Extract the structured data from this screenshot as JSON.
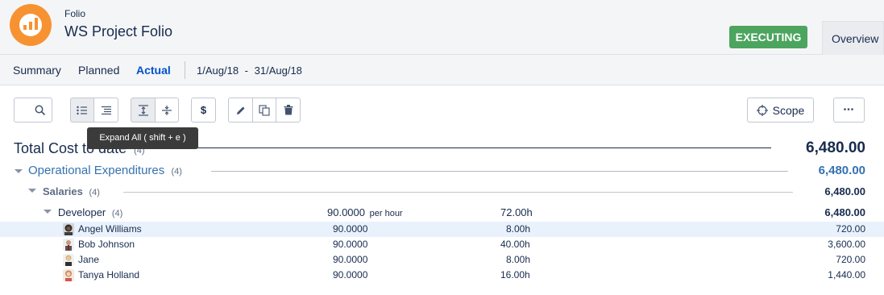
{
  "header": {
    "app_label": "Folio",
    "project_title": "WS Project Folio",
    "status": "EXECUTING",
    "overview_tab": "Overview"
  },
  "nav": {
    "tabs": [
      {
        "label": "Summary",
        "active": false
      },
      {
        "label": "Planned",
        "active": false
      },
      {
        "label": "Actual",
        "active": true
      }
    ],
    "date_from": "1/Aug/18",
    "date_sep": "-",
    "date_to": "31/Aug/18"
  },
  "toolbar": {
    "icons": [
      "search-icon",
      "list-view-icon",
      "indented-list-icon",
      "expand-all-icon",
      "collapse-all-icon",
      "currency-icon",
      "edit-icon",
      "copy-icon",
      "delete-icon",
      "target-icon",
      "more-icon"
    ],
    "currency_symbol": "$",
    "scope_label": "Scope",
    "more_label": "•••",
    "tooltip": "Expand All ( shift + e )"
  },
  "totals": {
    "label": "Total Cost to date",
    "count": "(4)",
    "amount": "6,480.00"
  },
  "groups": {
    "opex": {
      "label": "Operational Expenditures",
      "count": "(4)",
      "amount": "6,480.00"
    },
    "salaries": {
      "label": "Salaries",
      "count": "(4)",
      "amount": "6,480.00"
    },
    "developer": {
      "label": "Developer",
      "count": "(4)",
      "rate": "90.0000",
      "rate_unit": "per hour",
      "hours": "72.00h",
      "amount": "6,480.00"
    }
  },
  "people": [
    {
      "name": "Angel Williams",
      "rate": "90.0000",
      "hours": "8.00h",
      "amount": "720.00",
      "highlighted": true
    },
    {
      "name": "Bob Johnson",
      "rate": "90.0000",
      "hours": "40.00h",
      "amount": "3,600.00",
      "highlighted": false
    },
    {
      "name": "Jane",
      "rate": "90.0000",
      "hours": "8.00h",
      "amount": "720.00",
      "highlighted": false
    },
    {
      "name": "Tanya Holland",
      "rate": "90.0000",
      "hours": "16.00h",
      "amount": "1,440.00",
      "highlighted": false
    }
  ],
  "colors": {
    "accent": "#0052cc",
    "status": "#4ca55f",
    "logo": "#f79232",
    "opex": "#3572b0"
  }
}
